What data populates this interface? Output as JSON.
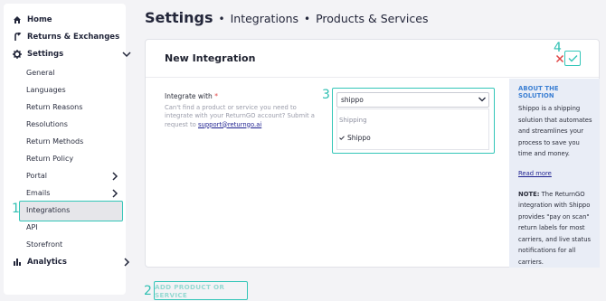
{
  "sidebar": {
    "home": "Home",
    "returns": "Returns & Exchanges",
    "settings": "Settings",
    "sub_items": [
      {
        "label": "General"
      },
      {
        "label": "Languages"
      },
      {
        "label": "Return Reasons"
      },
      {
        "label": "Resolutions"
      },
      {
        "label": "Return Methods"
      },
      {
        "label": "Return Policy"
      },
      {
        "label": "Portal"
      },
      {
        "label": "Emails"
      },
      {
        "label": "Integrations"
      },
      {
        "label": "API"
      },
      {
        "label": "Storefront"
      }
    ],
    "analytics": "Analytics"
  },
  "header": {
    "title": "Settings",
    "crumb1": "Integrations",
    "crumb2": "Products & Services",
    "sep": "•"
  },
  "card": {
    "title": "New Integration",
    "field_label": "Integrate with",
    "required_mark": "*",
    "help_text": "Can't find a product or service you need to integrate with your ReturnGO account? Submit a request to",
    "help_email": "support@returngo.ai",
    "select_value": "shippo",
    "menu_group": "Shipping",
    "menu_item": "Shippo",
    "about_title": "ABOUT THE SOLUTION",
    "about_text": "Shippo is a shipping solution that automates and streamlines your process to save you time and money.",
    "read_more": "Read more",
    "note_label": "NOTE:",
    "note_text": "The ReturnGO integration with Shippo provides \"pay on scan\" return labels for most carriers, and live status notifications for all carriers."
  },
  "add_button": "ADD PRODUCT OR SERVICE",
  "markers": {
    "m1": "1",
    "m2": "2",
    "m3": "3",
    "m4": "4"
  },
  "colors": {
    "accent": "#33c6b8",
    "about_bg": "#e9edf6",
    "link": "#1c1f8f",
    "danger": "#e04646"
  }
}
